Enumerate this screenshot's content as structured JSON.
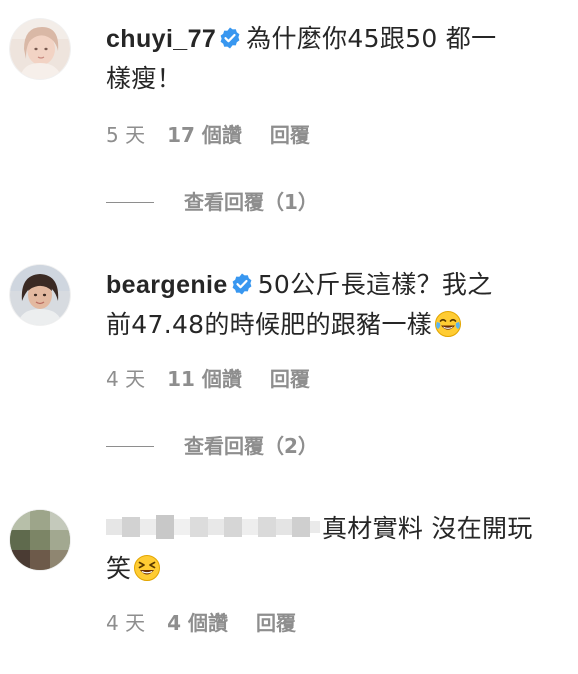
{
  "comments": [
    {
      "username": "chuyi_77",
      "text_line1": "為什麼你45跟50 都一",
      "text_line2": "樣瘦！",
      "time": "5 天",
      "likes": "17 個讚",
      "reply": "回覆",
      "view_replies": "查看回覆（1）"
    },
    {
      "username": "beargenie",
      "text_line1": "50公斤長這樣？我之",
      "text_line2": "前47.48的時候肥的跟豬一樣",
      "time": "4 天",
      "likes": "11 個讚",
      "reply": "回覆",
      "view_replies": "查看回覆（2）"
    },
    {
      "username": "",
      "text_line1": "真材實料 沒在開玩",
      "text_line2": "笑",
      "time": "4 天",
      "likes": "4 個讚",
      "reply": "回覆"
    }
  ],
  "icons": {
    "verified": "verified-badge-icon",
    "emoji_laugh": "face-with-tears-of-joy-icon",
    "emoji_grin": "grinning-squinting-face-icon"
  },
  "colors": {
    "text": "#262626",
    "muted": "#8e8e8e",
    "verified_blue": "#3897f0"
  }
}
